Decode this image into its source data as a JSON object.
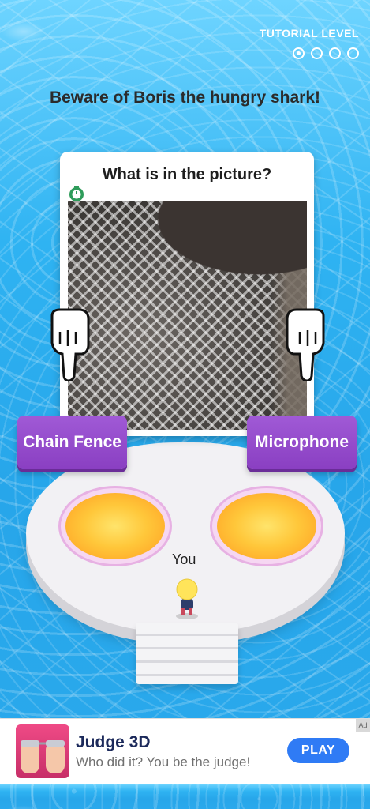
{
  "header": {
    "level_label": "TUTORIAL LEVEL",
    "progress": {
      "total": 4,
      "current": 1
    }
  },
  "headline": "Beware of Boris the hungry shark!",
  "question_card": {
    "title": "What is in the picture?",
    "timer_icon": "stopwatch-icon",
    "image_subject": "metal mesh close-up"
  },
  "answers": {
    "left": "Chain Fence",
    "right": "Microphone"
  },
  "player_label": "You",
  "ad": {
    "title": "Judge 3D",
    "subtitle": "Who did it? You be the judge!",
    "cta": "PLAY",
    "badge": "Ad"
  },
  "colors": {
    "answer_button": "#8a3fc2",
    "ad_cta": "#2f7bf5",
    "water": "#2aa9ec",
    "pad": "#ffc73a"
  }
}
